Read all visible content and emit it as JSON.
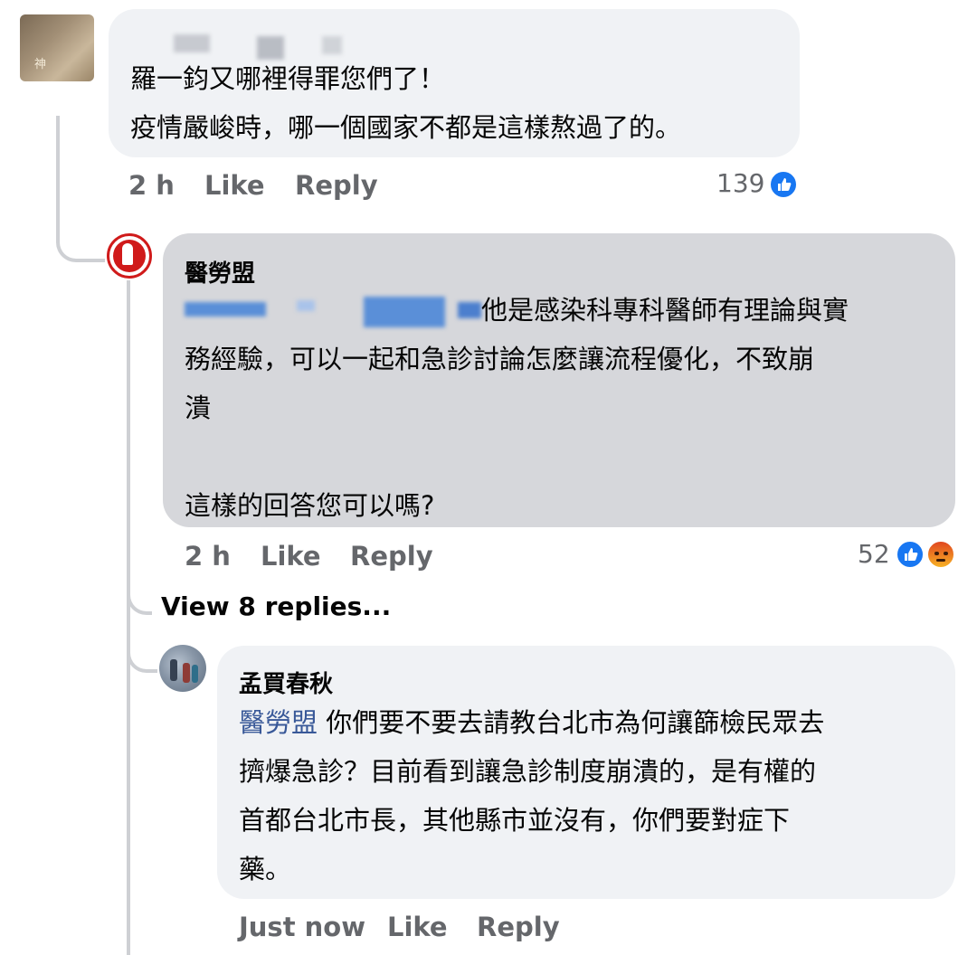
{
  "comments": [
    {
      "author": "",
      "avatar_tag": "神",
      "text": "羅一鈞又哪裡得罪您們了！\n疫情嚴峻時，哪一個國家不都是這樣熬過了的。",
      "time": "2 h",
      "like_label": "Like",
      "reply_label": "Reply",
      "reaction_count": "139",
      "reactions": [
        "like-icon"
      ]
    },
    {
      "author": "醫勞盟",
      "text": "他是感染科專科醫師有理論與實\n務經驗，可以一起和急診討論怎麼讓流程優化，不致崩\n潰\n\n這樣的回答您可以嗎?",
      "time": "2 h",
      "like_label": "Like",
      "reply_label": "Reply",
      "reaction_count": "52",
      "reactions": [
        "like-icon",
        "angry-icon"
      ]
    },
    {
      "author": "孟買春秋",
      "mention": "醫勞盟",
      "text": " 你們要不要去請教台北市為何讓篩檢民眾去\n擠爆急診？目前看到讓急診制度崩潰的，是有權的\n首都台北市長，其他縣市並沒有，你們要對症下\n藥。",
      "time": "Just now",
      "like_label": "Like",
      "reply_label": "Reply"
    }
  ],
  "view_replies_label": "View 8 replies...",
  "colors": {
    "bubble": "#f0f2f5",
    "bubble_highlight": "#d6d7db",
    "meta_text": "#65676b",
    "like_blue": "#1877f2",
    "mention": "#385898"
  }
}
